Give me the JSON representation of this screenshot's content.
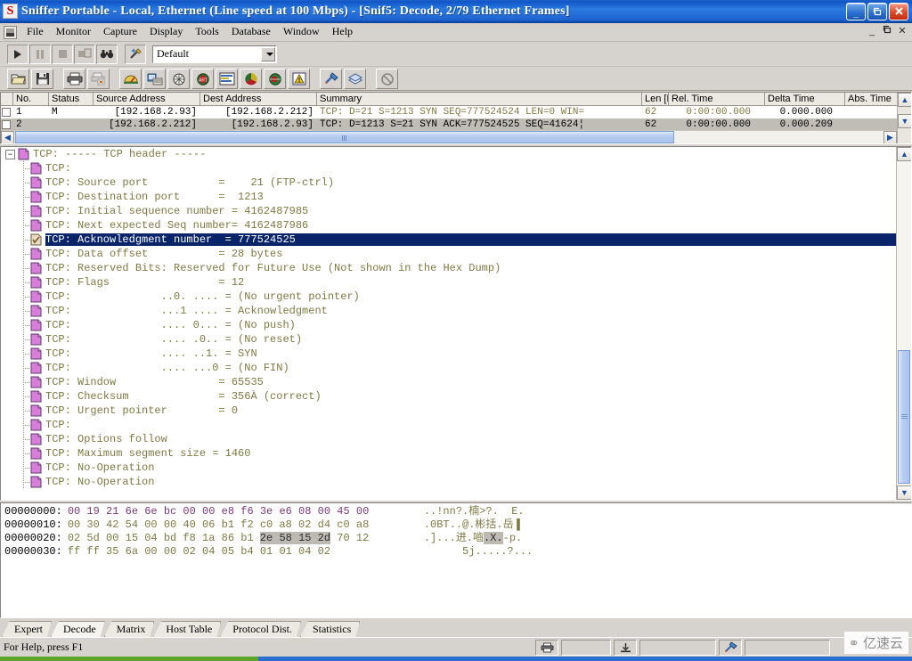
{
  "window": {
    "title": "Sniffer Portable - Local, Ethernet (Line speed at 100 Mbps) - [Snif5: Decode, 2/79 Ethernet Frames]",
    "app_icon_letter": "S",
    "minimize": "_",
    "maximize": "❐",
    "close": "✕",
    "mdi_minimize": "_",
    "mdi_restore": "❐",
    "mdi_close": "✕"
  },
  "menu": {
    "items": [
      {
        "label": "File"
      },
      {
        "label": "Monitor"
      },
      {
        "label": "Capture"
      },
      {
        "label": "Display"
      },
      {
        "label": "Tools"
      },
      {
        "label": "Database"
      },
      {
        "label": "Window"
      },
      {
        "label": "Help"
      }
    ]
  },
  "toolbar": {
    "buttons": [
      {
        "name": "start-capture-button",
        "icon": "play-icon"
      },
      {
        "name": "pause-capture-button",
        "icon": "pause-icon"
      },
      {
        "name": "stop-capture-button",
        "icon": "stop-icon"
      },
      {
        "name": "stop-and-display-button",
        "icon": "stop-display-icon"
      },
      {
        "name": "find-button",
        "icon": "binoculars-icon"
      },
      {
        "name": "capture-settings-button",
        "icon": "wand-icon"
      }
    ],
    "profile_combo": {
      "value": "Default",
      "name": "capture-profile-combo"
    }
  },
  "toolbar2": {
    "buttons": [
      {
        "name": "open-file-button",
        "icon": "open-folder-icon"
      },
      {
        "name": "save-file-button",
        "icon": "floppy-disk-icon"
      },
      {
        "name": "print-button",
        "icon": "printer-icon"
      },
      {
        "name": "print-preview-button",
        "icon": "print-cancel-icon"
      },
      {
        "name": "dashboard-button",
        "icon": "gauge-icon"
      },
      {
        "name": "host-table-button",
        "icon": "host-table-icon"
      },
      {
        "name": "matrix-button",
        "icon": "matrix-globe-icon"
      },
      {
        "name": "art-button",
        "icon": "art-response-time-icon"
      },
      {
        "name": "history-button",
        "icon": "history-chart-icon"
      },
      {
        "name": "protocol-dist-button",
        "icon": "pie-chart-icon"
      },
      {
        "name": "global-statistics-button",
        "icon": "globe-icon"
      },
      {
        "name": "alarm-log-button",
        "icon": "alarm-warning-icon"
      },
      {
        "name": "expert-button",
        "icon": "expert-icon"
      },
      {
        "name": "decode-button",
        "icon": "decode-layers-icon"
      },
      {
        "name": "stop-display-button",
        "icon": "no-entry-icon"
      }
    ]
  },
  "packet_list": {
    "columns": [
      {
        "label": "No."
      },
      {
        "label": "Status"
      },
      {
        "label": "Source Address"
      },
      {
        "label": "Dest Address"
      },
      {
        "label": "Summary"
      },
      {
        "label": "Len [B]"
      },
      {
        "label": "Rel. Time"
      },
      {
        "label": "Delta Time"
      },
      {
        "label": "Abs. Time"
      }
    ],
    "rows": [
      {
        "no": "1",
        "status": "M",
        "source": "[192.168.2.93]",
        "dest": "[192.168.2.212]",
        "summary": "TCP: D=21 S=1213 SYN SEQ=777524524 LEN=0 WIN=",
        "len": "62",
        "rel_time": "0:00:00.000",
        "delta_time": "0.000.000",
        "abs_time": "",
        "selected": false
      },
      {
        "no": "2",
        "status": "",
        "source": "[192.168.2.212]",
        "dest": "[192.168.2.93]",
        "summary": "TCP: D=1213 S=21 SYN ACK=777524525 SEQ=41624¦",
        "len": "62",
        "rel_time": "0:00:00.000",
        "delta_time": "0.000.209",
        "abs_time": "",
        "selected": true
      }
    ]
  },
  "decode_tree": {
    "rows": [
      {
        "text": "TCP: ----- TCP header -----",
        "root": true,
        "selected": false
      },
      {
        "text": "TCP:",
        "root": false,
        "selected": false
      },
      {
        "text": "TCP: Source port           =    21 (FTP-ctrl)",
        "root": false,
        "selected": false
      },
      {
        "text": "TCP: Destination port      =  1213",
        "root": false,
        "selected": false
      },
      {
        "text": "TCP: Initial sequence number = 4162487985",
        "root": false,
        "selected": false
      },
      {
        "text": "TCP: Next expected Seq number= 4162487986",
        "root": false,
        "selected": false
      },
      {
        "text": "TCP: Acknowledgment number  = 777524525",
        "root": false,
        "selected": true
      },
      {
        "text": "TCP: Data offset           = 28 bytes",
        "root": false,
        "selected": false
      },
      {
        "text": "TCP: Reserved Bits: Reserved for Future Use (Not shown in the Hex Dump)",
        "root": false,
        "selected": false
      },
      {
        "text": "TCP: Flags                 = 12",
        "root": false,
        "selected": false
      },
      {
        "text": "TCP:              ..0. .... = (No urgent pointer)",
        "root": false,
        "selected": false
      },
      {
        "text": "TCP:              ...1 .... = Acknowledgment",
        "root": false,
        "selected": false
      },
      {
        "text": "TCP:              .... 0... = (No push)",
        "root": false,
        "selected": false
      },
      {
        "text": "TCP:              .... .0.. = (No reset)",
        "root": false,
        "selected": false
      },
      {
        "text": "TCP:              .... ..1. = SYN",
        "root": false,
        "selected": false
      },
      {
        "text": "TCP:              .... ...0 = (No FIN)",
        "root": false,
        "selected": false
      },
      {
        "text": "TCP: Window                = 65535",
        "root": false,
        "selected": false
      },
      {
        "text": "TCP: Checksum              = 356À (correct)",
        "root": false,
        "selected": false
      },
      {
        "text": "TCP: Urgent pointer        = 0",
        "root": false,
        "selected": false
      },
      {
        "text": "TCP:",
        "root": false,
        "selected": false
      },
      {
        "text": "TCP: Options follow",
        "root": false,
        "selected": false
      },
      {
        "text": "TCP: Maximum segment size = 1460",
        "root": false,
        "selected": false
      },
      {
        "text": "TCP: No-Operation",
        "root": false,
        "selected": false
      },
      {
        "text": "TCP: No-Operation",
        "root": false,
        "selected": false
      }
    ]
  },
  "hex_dump": {
    "rows": [
      {
        "offset": "00000000:",
        "bytes_pre": "00 19 21 6e 6e bc 00 00 e8 f6 3e e6 08 00 45 00",
        "bytes_hl": "",
        "bytes_post": "",
        "magenta": true,
        "ascii_pre": "..!nn?.楠>?.  E.",
        "ascii_hl": "",
        "ascii_post": ""
      },
      {
        "offset": "00000010:",
        "bytes_pre": "00 30 42 54 00 00 40 06 b1 f2 c0 a8 02 d4 c0 a8",
        "bytes_hl": "",
        "bytes_post": "",
        "magenta": false,
        "ascii_pre": ".0BT..@.彬括.岳▐",
        "ascii_hl": "",
        "ascii_post": ""
      },
      {
        "offset": "00000020:",
        "bytes_pre": "02 5d 00 15 04 bd f8 1a 86 b1 ",
        "bytes_hl": "2e 58 15 2d",
        "bytes_post": " 70 12",
        "magenta": false,
        "ascii_pre": ".]...进.嚙",
        "ascii_hl": ".X.",
        "ascii_post": "-p."
      },
      {
        "offset": "00000030:",
        "bytes_pre": "ff ff 35 6a 00 00 02 04 05 b4 01 01 04 02",
        "bytes_hl": "",
        "bytes_post": "",
        "magenta": false,
        "ascii_pre": "      5j.....?...",
        "ascii_hl": "",
        "ascii_post": ""
      }
    ]
  },
  "tabs": {
    "items": [
      {
        "label": "Expert",
        "active": false
      },
      {
        "label": "Decode",
        "active": true
      },
      {
        "label": "Matrix",
        "active": false
      },
      {
        "label": "Host Table",
        "active": false
      },
      {
        "label": "Protocol Dist.",
        "active": false
      },
      {
        "label": "Statistics",
        "active": false
      }
    ]
  },
  "status_bar": {
    "help_text": "For Help, press F1",
    "cells": [
      {
        "name": "status-printer-icon",
        "icon": "printer-icon"
      },
      {
        "name": "status-field-1",
        "icon": ""
      },
      {
        "name": "status-capture-icon",
        "icon": "save-arrow-icon"
      },
      {
        "name": "status-field-2",
        "icon": ""
      },
      {
        "name": "status-expert-icon",
        "icon": "expert-icon"
      },
      {
        "name": "status-field-3",
        "icon": ""
      }
    ]
  },
  "watermark": {
    "text": "亿速云"
  },
  "colors": {
    "title_blue": "#1f63d2",
    "selection_blue": "#0a246a",
    "tree_olive": "#7d7a45",
    "hex_magenta": "#7a3a7a",
    "row_selected_gray": "#c0bdb6",
    "face": "#d6d3ce"
  }
}
